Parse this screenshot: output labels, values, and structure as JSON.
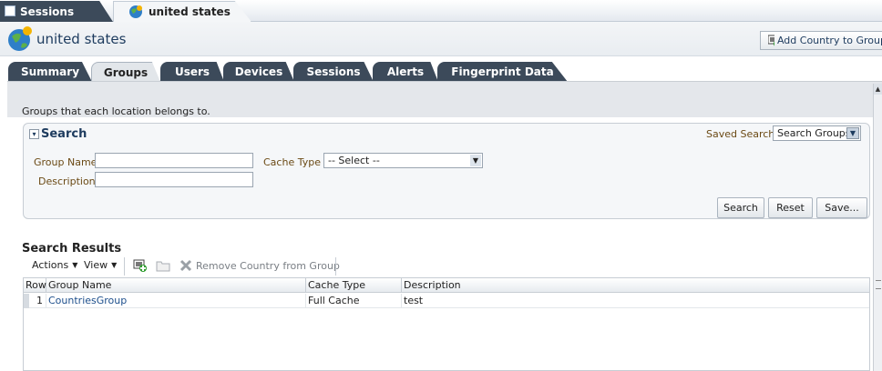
{
  "doc_tabs": {
    "sessions": "Sessions",
    "location": "united states"
  },
  "header": {
    "title": "united states",
    "add_button": "Add Country to Group"
  },
  "tabs": [
    "Summary",
    "Groups",
    "Users",
    "Devices",
    "Sessions",
    "Alerts",
    "Fingerprint Data"
  ],
  "active_tab": "Groups",
  "description": "Groups that each location belongs to.",
  "search": {
    "title": "Search",
    "saved_search_label": "Saved Search",
    "saved_search_value": "Search Groups",
    "group_name_label": "Group Name",
    "group_name_value": "",
    "description_label": "Description",
    "description_value": "",
    "cache_type_label": "Cache Type",
    "cache_type_value": "-- Select --",
    "buttons": {
      "search": "Search",
      "reset": "Reset",
      "save": "Save..."
    }
  },
  "results": {
    "title": "Search Results",
    "toolbar": {
      "actions": "Actions",
      "view": "View",
      "remove": "Remove Country from Group"
    },
    "columns": [
      "Row",
      "Group Name",
      "Cache Type",
      "Description"
    ],
    "rows": [
      {
        "row": "1",
        "group_name": "CountriesGroup",
        "cache_type": "Full Cache",
        "description": "test"
      }
    ]
  }
}
